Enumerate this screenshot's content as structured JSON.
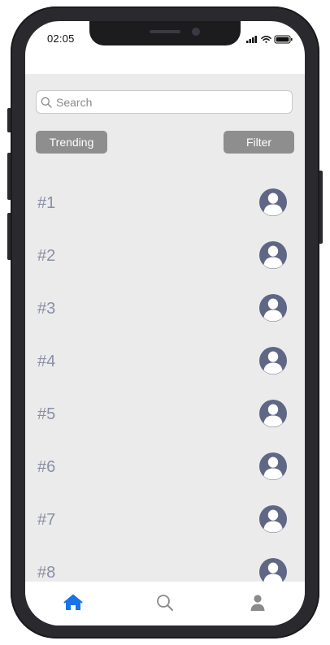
{
  "status_bar": {
    "time": "02:05"
  },
  "search": {
    "placeholder": "Search"
  },
  "filters": {
    "trending_label": "Trending",
    "filter_label": "Filter"
  },
  "list": {
    "items": [
      {
        "rank": "#1"
      },
      {
        "rank": "#2"
      },
      {
        "rank": "#3"
      },
      {
        "rank": "#4"
      },
      {
        "rank": "#5"
      },
      {
        "rank": "#6"
      },
      {
        "rank": "#7"
      },
      {
        "rank": "#8"
      }
    ]
  },
  "tabbar": {
    "items": [
      {
        "icon": "home-icon",
        "active": true
      },
      {
        "icon": "search-icon",
        "active": false
      },
      {
        "icon": "profile-icon",
        "active": false
      }
    ]
  },
  "colors": {
    "accent": "#1a73e8",
    "avatar": "#5f6785",
    "rank_text": "#8a8fa6",
    "pill_bg": "#8e8e8e",
    "content_bg": "#ebebeb"
  }
}
